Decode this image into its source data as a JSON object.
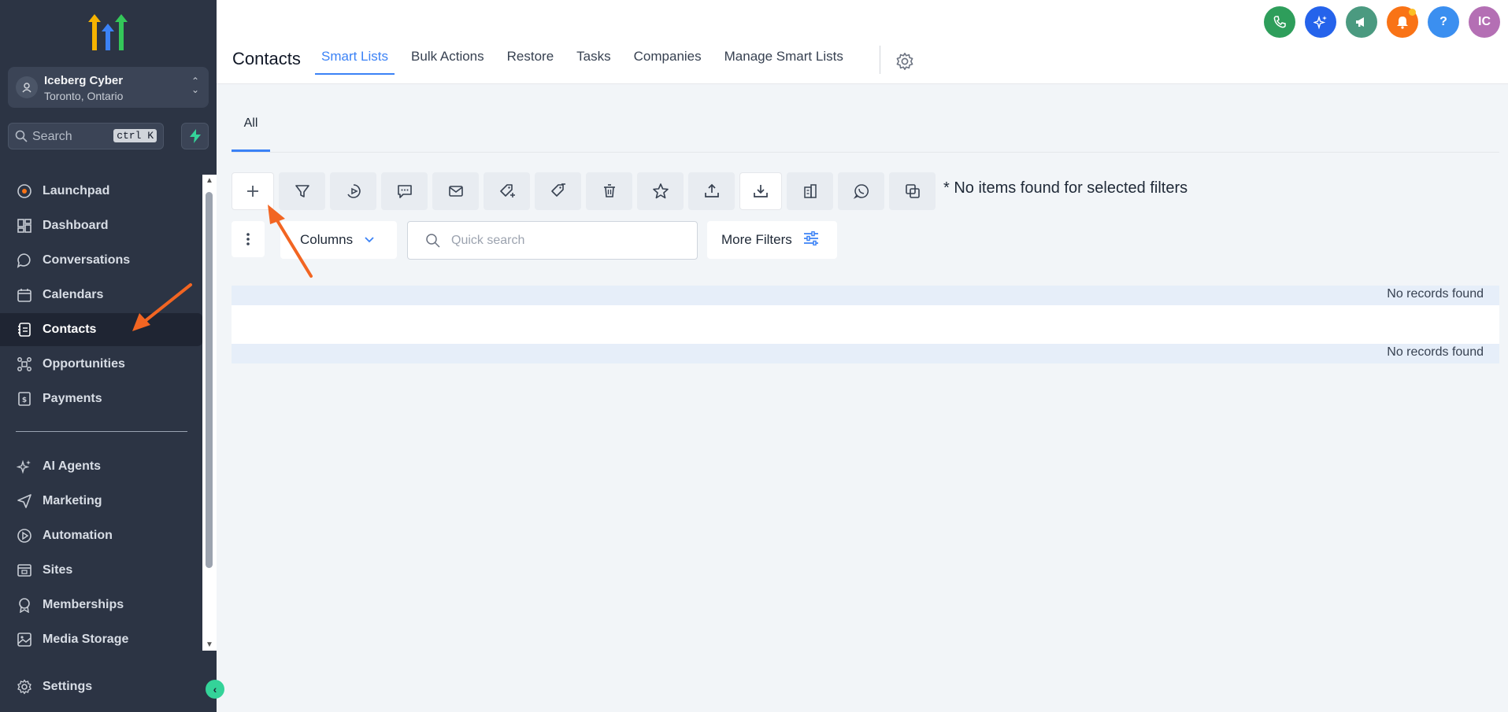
{
  "account": {
    "name": "Iceberg Cyber",
    "location": "Toronto, Ontario"
  },
  "search": {
    "placeholder": "Search",
    "shortcut": "ctrl K"
  },
  "sidebar": {
    "items": [
      {
        "label": "Launchpad",
        "icon": "launchpad-icon"
      },
      {
        "label": "Dashboard",
        "icon": "dashboard-icon"
      },
      {
        "label": "Conversations",
        "icon": "chat-bubble-icon"
      },
      {
        "label": "Calendars",
        "icon": "calendar-icon"
      },
      {
        "label": "Contacts",
        "icon": "contacts-icon",
        "active": true
      },
      {
        "label": "Opportunities",
        "icon": "opportunities-icon"
      },
      {
        "label": "Payments",
        "icon": "payments-icon"
      },
      {
        "label": "AI Agents",
        "icon": "sparkle-icon"
      },
      {
        "label": "Marketing",
        "icon": "send-icon"
      },
      {
        "label": "Automation",
        "icon": "automation-icon"
      },
      {
        "label": "Sites",
        "icon": "sites-icon"
      },
      {
        "label": "Memberships",
        "icon": "badge-icon"
      },
      {
        "label": "Media Storage",
        "icon": "image-icon"
      }
    ],
    "settings_label": "Settings"
  },
  "header": {
    "title": "Contacts",
    "tabs": [
      {
        "label": "Smart Lists",
        "active": true
      },
      {
        "label": "Bulk Actions"
      },
      {
        "label": "Restore"
      },
      {
        "label": "Tasks"
      },
      {
        "label": "Companies"
      },
      {
        "label": "Manage Smart Lists"
      }
    ],
    "avatar_initials": "IC",
    "help_label": "?"
  },
  "colors": {
    "phone": "#2e9e5b",
    "ai": "#2563eb",
    "announce": "#4b9a80",
    "bell": "#f97316",
    "help": "#3b8ff0",
    "avatar": "#b46fb4",
    "accent": "#3b82f6",
    "annotation": "#f26522"
  },
  "subtabs": {
    "all": "All"
  },
  "toolbar": {
    "buttons": [
      "add-icon",
      "filter-icon",
      "workflow-icon",
      "sms-icon",
      "email-icon",
      "add-tag-icon",
      "remove-tag-icon",
      "delete-icon",
      "star-icon",
      "export-icon",
      "import-icon",
      "company-icon",
      "whatsapp-icon",
      "duplicate-icon"
    ],
    "no_items": "* No items found for selected filters"
  },
  "filters": {
    "columns_label": "Columns",
    "quick_search_placeholder": "Quick search",
    "more_filters_label": "More Filters"
  },
  "records": {
    "empty_top": "No records found",
    "empty_bottom": "No records found"
  }
}
